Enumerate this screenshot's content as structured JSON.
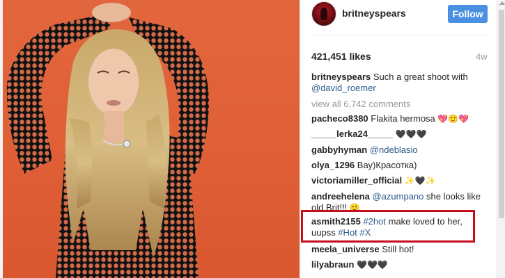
{
  "post": {
    "username": "britneyspears",
    "follow_label": "Follow",
    "likes": "421,451 likes",
    "age": "4w"
  },
  "caption": {
    "author": "britneyspears",
    "text": "Such a great shoot with",
    "mention": "@david_roemer"
  },
  "view_all": "view all 6,742 comments",
  "comments": [
    {
      "author": "pacheco8380",
      "text": "Flakita hermosa",
      "extra": "💖🙂💖"
    },
    {
      "author": "_____lerka24_____",
      "text": "",
      "extra": "🖤🖤🖤"
    },
    {
      "author": "gabbyhyman",
      "text": "",
      "extra": "@ndeblasio"
    },
    {
      "author": "olya_1296",
      "text": "Вау)Красотка)",
      "extra": ""
    },
    {
      "author": "victoriamiller_official",
      "text": "",
      "extra": "✨🖤✨"
    },
    {
      "author": "andreehelena",
      "mention": "@azumpano",
      "text": "she looks like old Brit!!!",
      "extra": "🙂"
    },
    {
      "author": "asmith2155",
      "tag1": "#2hot",
      "text": "make loved to her, uupss",
      "tag2": "#Hot",
      "tag3": "#X"
    },
    {
      "author": "meela_universe",
      "text": "Still hot!",
      "extra": ""
    },
    {
      "author": "lilyabraun",
      "text": "",
      "extra": "🖤🖤🖤"
    }
  ],
  "icons": {
    "avatar": "profile-avatar",
    "scroll_up": "scroll-up-arrow-icon"
  },
  "colors": {
    "follow_button": "#4a90e2",
    "highlight_border": "#c40e1a",
    "link": "#2a5a8c",
    "photo_background": "#e2663d"
  }
}
